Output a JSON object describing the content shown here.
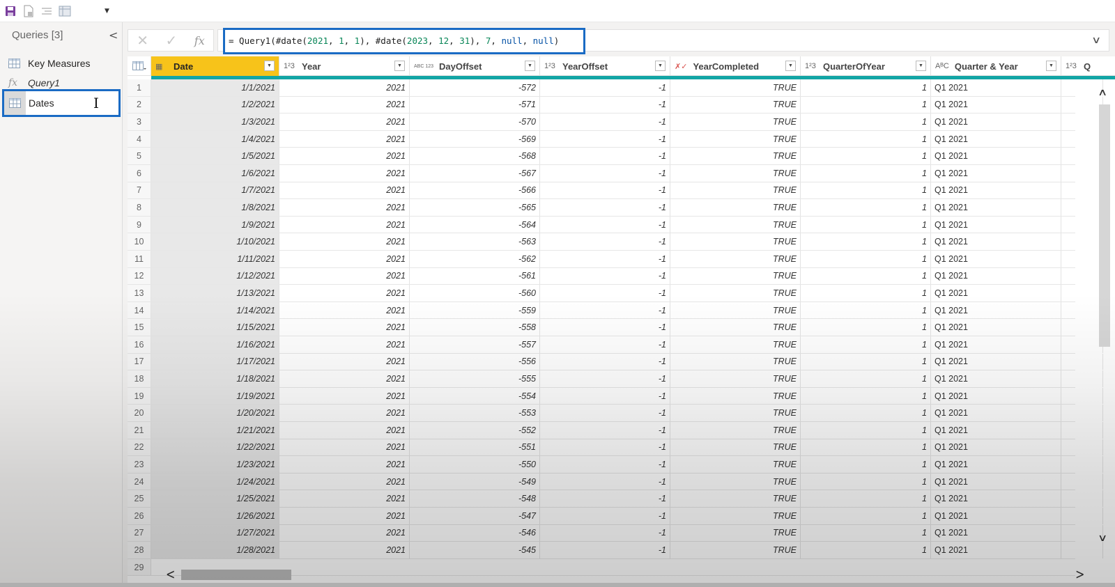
{
  "qat": {
    "icons": [
      "save-icon",
      "new-file-icon",
      "align-icon",
      "table-view-icon"
    ],
    "dropdown_glyph": "▼"
  },
  "queries": {
    "title": "Queries [3]",
    "collapse_glyph": "<",
    "items": [
      {
        "label": "Key Measures",
        "icon": "table-icon",
        "type": "table"
      },
      {
        "label": "Query1",
        "icon": "function-icon",
        "type": "function"
      },
      {
        "label": "Dates",
        "icon": "table-icon",
        "type": "table",
        "renaming": true
      }
    ]
  },
  "formula_bar": {
    "cancel_glyph": "✕",
    "commit_glyph": "✓",
    "fx_label": "fx",
    "tokens": [
      {
        "t": "= Query1(#date(",
        "c": "p"
      },
      {
        "t": "2021",
        "c": "n"
      },
      {
        "t": ", ",
        "c": "p"
      },
      {
        "t": "1",
        "c": "n"
      },
      {
        "t": ", ",
        "c": "p"
      },
      {
        "t": "1",
        "c": "n"
      },
      {
        "t": "), #date(",
        "c": "p"
      },
      {
        "t": "2023",
        "c": "n"
      },
      {
        "t": ", ",
        "c": "p"
      },
      {
        "t": "12",
        "c": "n"
      },
      {
        "t": ", ",
        "c": "p"
      },
      {
        "t": "31",
        "c": "n"
      },
      {
        "t": "), ",
        "c": "p"
      },
      {
        "t": "7",
        "c": "n"
      },
      {
        "t": ", ",
        "c": "p"
      },
      {
        "t": "null",
        "c": "k"
      },
      {
        "t": ", ",
        "c": "p"
      },
      {
        "t": "null",
        "c": "k"
      },
      {
        "t": ")",
        "c": "p"
      }
    ],
    "expand_glyph": "∨"
  },
  "grid": {
    "columns": [
      {
        "name": "Date",
        "type_glyph": "▦",
        "type": "date",
        "selected": true
      },
      {
        "name": "Year",
        "type_glyph": "1²3",
        "type": "number"
      },
      {
        "name": "DayOffset",
        "type_glyph": "ABC 123",
        "type": "any"
      },
      {
        "name": "YearOffset",
        "type_glyph": "1²3",
        "type": "number"
      },
      {
        "name": "YearCompleted",
        "type_glyph": "✗✓",
        "type": "logical"
      },
      {
        "name": "QuarterOfYear",
        "type_glyph": "1²3",
        "type": "number"
      },
      {
        "name": "Quarter & Year",
        "type_glyph": "AᴮC",
        "type": "text"
      },
      {
        "name": "Q",
        "type_glyph": "1²3",
        "type": "number",
        "partial": true
      }
    ],
    "rows": [
      [
        "1",
        "1/1/2021",
        "2021",
        "-572",
        "-1",
        "TRUE",
        "1",
        "Q1 2021"
      ],
      [
        "2",
        "1/2/2021",
        "2021",
        "-571",
        "-1",
        "TRUE",
        "1",
        "Q1 2021"
      ],
      [
        "3",
        "1/3/2021",
        "2021",
        "-570",
        "-1",
        "TRUE",
        "1",
        "Q1 2021"
      ],
      [
        "4",
        "1/4/2021",
        "2021",
        "-569",
        "-1",
        "TRUE",
        "1",
        "Q1 2021"
      ],
      [
        "5",
        "1/5/2021",
        "2021",
        "-568",
        "-1",
        "TRUE",
        "1",
        "Q1 2021"
      ],
      [
        "6",
        "1/6/2021",
        "2021",
        "-567",
        "-1",
        "TRUE",
        "1",
        "Q1 2021"
      ],
      [
        "7",
        "1/7/2021",
        "2021",
        "-566",
        "-1",
        "TRUE",
        "1",
        "Q1 2021"
      ],
      [
        "8",
        "1/8/2021",
        "2021",
        "-565",
        "-1",
        "TRUE",
        "1",
        "Q1 2021"
      ],
      [
        "9",
        "1/9/2021",
        "2021",
        "-564",
        "-1",
        "TRUE",
        "1",
        "Q1 2021"
      ],
      [
        "10",
        "1/10/2021",
        "2021",
        "-563",
        "-1",
        "TRUE",
        "1",
        "Q1 2021"
      ],
      [
        "11",
        "1/11/2021",
        "2021",
        "-562",
        "-1",
        "TRUE",
        "1",
        "Q1 2021"
      ],
      [
        "12",
        "1/12/2021",
        "2021",
        "-561",
        "-1",
        "TRUE",
        "1",
        "Q1 2021"
      ],
      [
        "13",
        "1/13/2021",
        "2021",
        "-560",
        "-1",
        "TRUE",
        "1",
        "Q1 2021"
      ],
      [
        "14",
        "1/14/2021",
        "2021",
        "-559",
        "-1",
        "TRUE",
        "1",
        "Q1 2021"
      ],
      [
        "15",
        "1/15/2021",
        "2021",
        "-558",
        "-1",
        "TRUE",
        "1",
        "Q1 2021"
      ],
      [
        "16",
        "1/16/2021",
        "2021",
        "-557",
        "-1",
        "TRUE",
        "1",
        "Q1 2021"
      ],
      [
        "17",
        "1/17/2021",
        "2021",
        "-556",
        "-1",
        "TRUE",
        "1",
        "Q1 2021"
      ],
      [
        "18",
        "1/18/2021",
        "2021",
        "-555",
        "-1",
        "TRUE",
        "1",
        "Q1 2021"
      ],
      [
        "19",
        "1/19/2021",
        "2021",
        "-554",
        "-1",
        "TRUE",
        "1",
        "Q1 2021"
      ],
      [
        "20",
        "1/20/2021",
        "2021",
        "-553",
        "-1",
        "TRUE",
        "1",
        "Q1 2021"
      ],
      [
        "21",
        "1/21/2021",
        "2021",
        "-552",
        "-1",
        "TRUE",
        "1",
        "Q1 2021"
      ],
      [
        "22",
        "1/22/2021",
        "2021",
        "-551",
        "-1",
        "TRUE",
        "1",
        "Q1 2021"
      ],
      [
        "23",
        "1/23/2021",
        "2021",
        "-550",
        "-1",
        "TRUE",
        "1",
        "Q1 2021"
      ],
      [
        "24",
        "1/24/2021",
        "2021",
        "-549",
        "-1",
        "TRUE",
        "1",
        "Q1 2021"
      ],
      [
        "25",
        "1/25/2021",
        "2021",
        "-548",
        "-1",
        "TRUE",
        "1",
        "Q1 2021"
      ],
      [
        "26",
        "1/26/2021",
        "2021",
        "-547",
        "-1",
        "TRUE",
        "1",
        "Q1 2021"
      ],
      [
        "27",
        "1/27/2021",
        "2021",
        "-546",
        "-1",
        "TRUE",
        "1",
        "Q1 2021"
      ],
      [
        "28",
        "1/28/2021",
        "2021",
        "-545",
        "-1",
        "TRUE",
        "1",
        "Q1 2021"
      ]
    ],
    "partial_row_number": "29",
    "scroll": {
      "up": "∧",
      "down": "∨",
      "left": "<",
      "right": ">"
    }
  }
}
